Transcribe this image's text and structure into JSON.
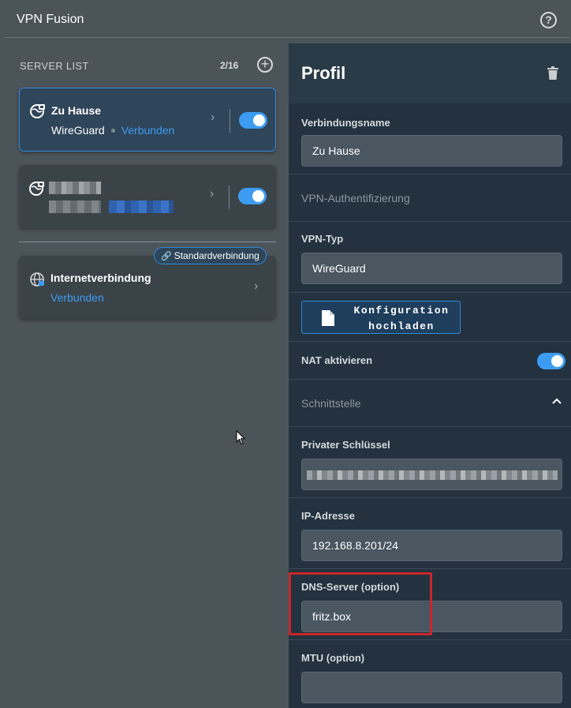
{
  "window": {
    "title": "VPN Fusion",
    "help_icon": "help-circle-icon"
  },
  "server_list": {
    "label": "SERVER LIST",
    "count": "2/16",
    "servers": [
      {
        "name": "Zu Hause",
        "protocol": "WireGuard",
        "status": "Verbunden",
        "enabled": true,
        "active": true
      },
      {
        "name": "",
        "protocol": "",
        "status": "",
        "enabled": true,
        "active": false
      }
    ],
    "default_badge": "Standardverbindung",
    "internet": {
      "name": "Internetverbindung",
      "status": "Verbunden"
    }
  },
  "profile": {
    "title": "Profil",
    "connection_name_label": "Verbindungsname",
    "connection_name_value": "Zu Hause",
    "vpn_auth_label": "VPN-Authentifizierung",
    "vpn_type_label": "VPN-Typ",
    "vpn_type_value": "WireGuard",
    "upload_line1": "Konfiguration",
    "upload_line2": "hochladen",
    "nat_label": "NAT aktivieren",
    "nat_enabled": true,
    "interface_label": "Schnittstelle",
    "private_key_label": "Privater Schlüssel",
    "ip_label": "IP-Adresse",
    "ip_value": "192.168.8.201/24",
    "dns_label": "DNS-Server (option)",
    "dns_value": "fritz.box",
    "mtu_label": "MTU (option)",
    "mtu_value": ""
  },
  "colors": {
    "accent": "#3d9cf2",
    "highlight": "#c8262b",
    "panel": "#23323e",
    "background": "#4b5459"
  }
}
